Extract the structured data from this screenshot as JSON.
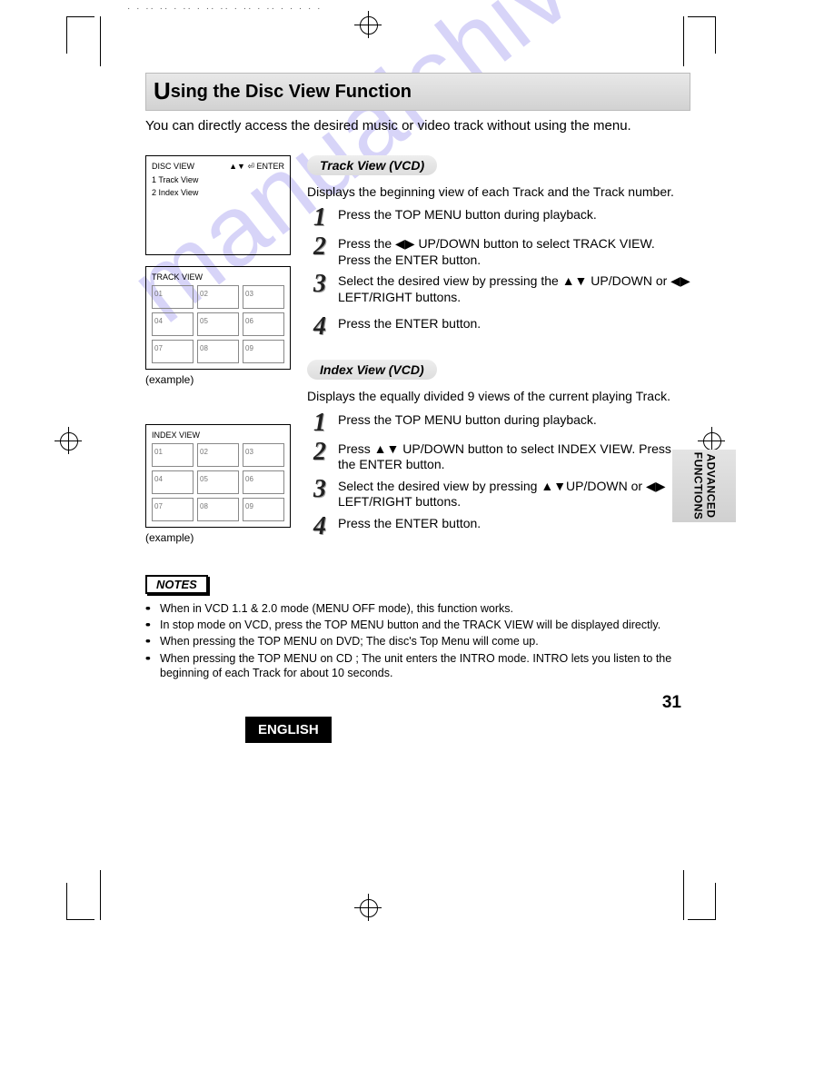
{
  "heading": {
    "cap": "U",
    "rest": "sing the Disc View Function"
  },
  "intro": "You can directly access the desired music or video track without using the menu.",
  "section1": {
    "title": "Track View (VCD)",
    "intro": "Displays the beginning view of each Track and the Track number.",
    "steps": [
      "Press the TOP MENU button during playback.",
      "Press the ◀▶ UP/DOWN button to select TRACK VIEW. Press the ENTER button.",
      "Select the desired view by pressing the ▲▼ UP/DOWN or ◀▶ LEFT/RIGHT buttons.",
      "Press the ENTER button."
    ]
  },
  "section2": {
    "title": "Index View (VCD)",
    "intro": "Displays the equally divided 9 views of the current playing Track.",
    "steps": [
      "Press the TOP MENU button during playback.",
      "Press ▲▼ UP/DOWN button to select INDEX VIEW. Press the ENTER button.",
      "Select the desired view by pressing ▲▼UP/DOWN or ◀▶ LEFT/RIGHT buttons.",
      "Press the ENTER button."
    ]
  },
  "screen_discview": {
    "title": "DISC VIEW",
    "right": "▲▼ ⏎ ENTER",
    "line1": "1  Track View",
    "line2": "2  Index View"
  },
  "screen_track": {
    "title": "TRACK VIEW",
    "cells": [
      "01",
      "02",
      "03",
      "04",
      "05",
      "06",
      "07",
      "08",
      "09"
    ]
  },
  "screen_index": {
    "title": "INDEX VIEW",
    "cells": [
      "01",
      "02",
      "03",
      "04",
      "05",
      "06",
      "07",
      "08",
      "09"
    ]
  },
  "example_label": "(example)",
  "notes_label": "NOTES",
  "notes": [
    "When in VCD 1.1 & 2.0 mode (MENU OFF mode), this function works.",
    "In stop mode on VCD, press the TOP MENU button and the TRACK VIEW will be displayed directly.",
    "When pressing the TOP MENU on DVD; The disc's Top Menu will come up.",
    "When pressing the TOP MENU on CD ; The unit enters the INTRO mode. INTRO lets you listen to the beginning of each Track for about 10 seconds."
  ],
  "page_number": "31",
  "language": "ENGLISH",
  "side_tab": "ADVANCED\nFUNCTIONS",
  "watermark": "manualchive.com"
}
